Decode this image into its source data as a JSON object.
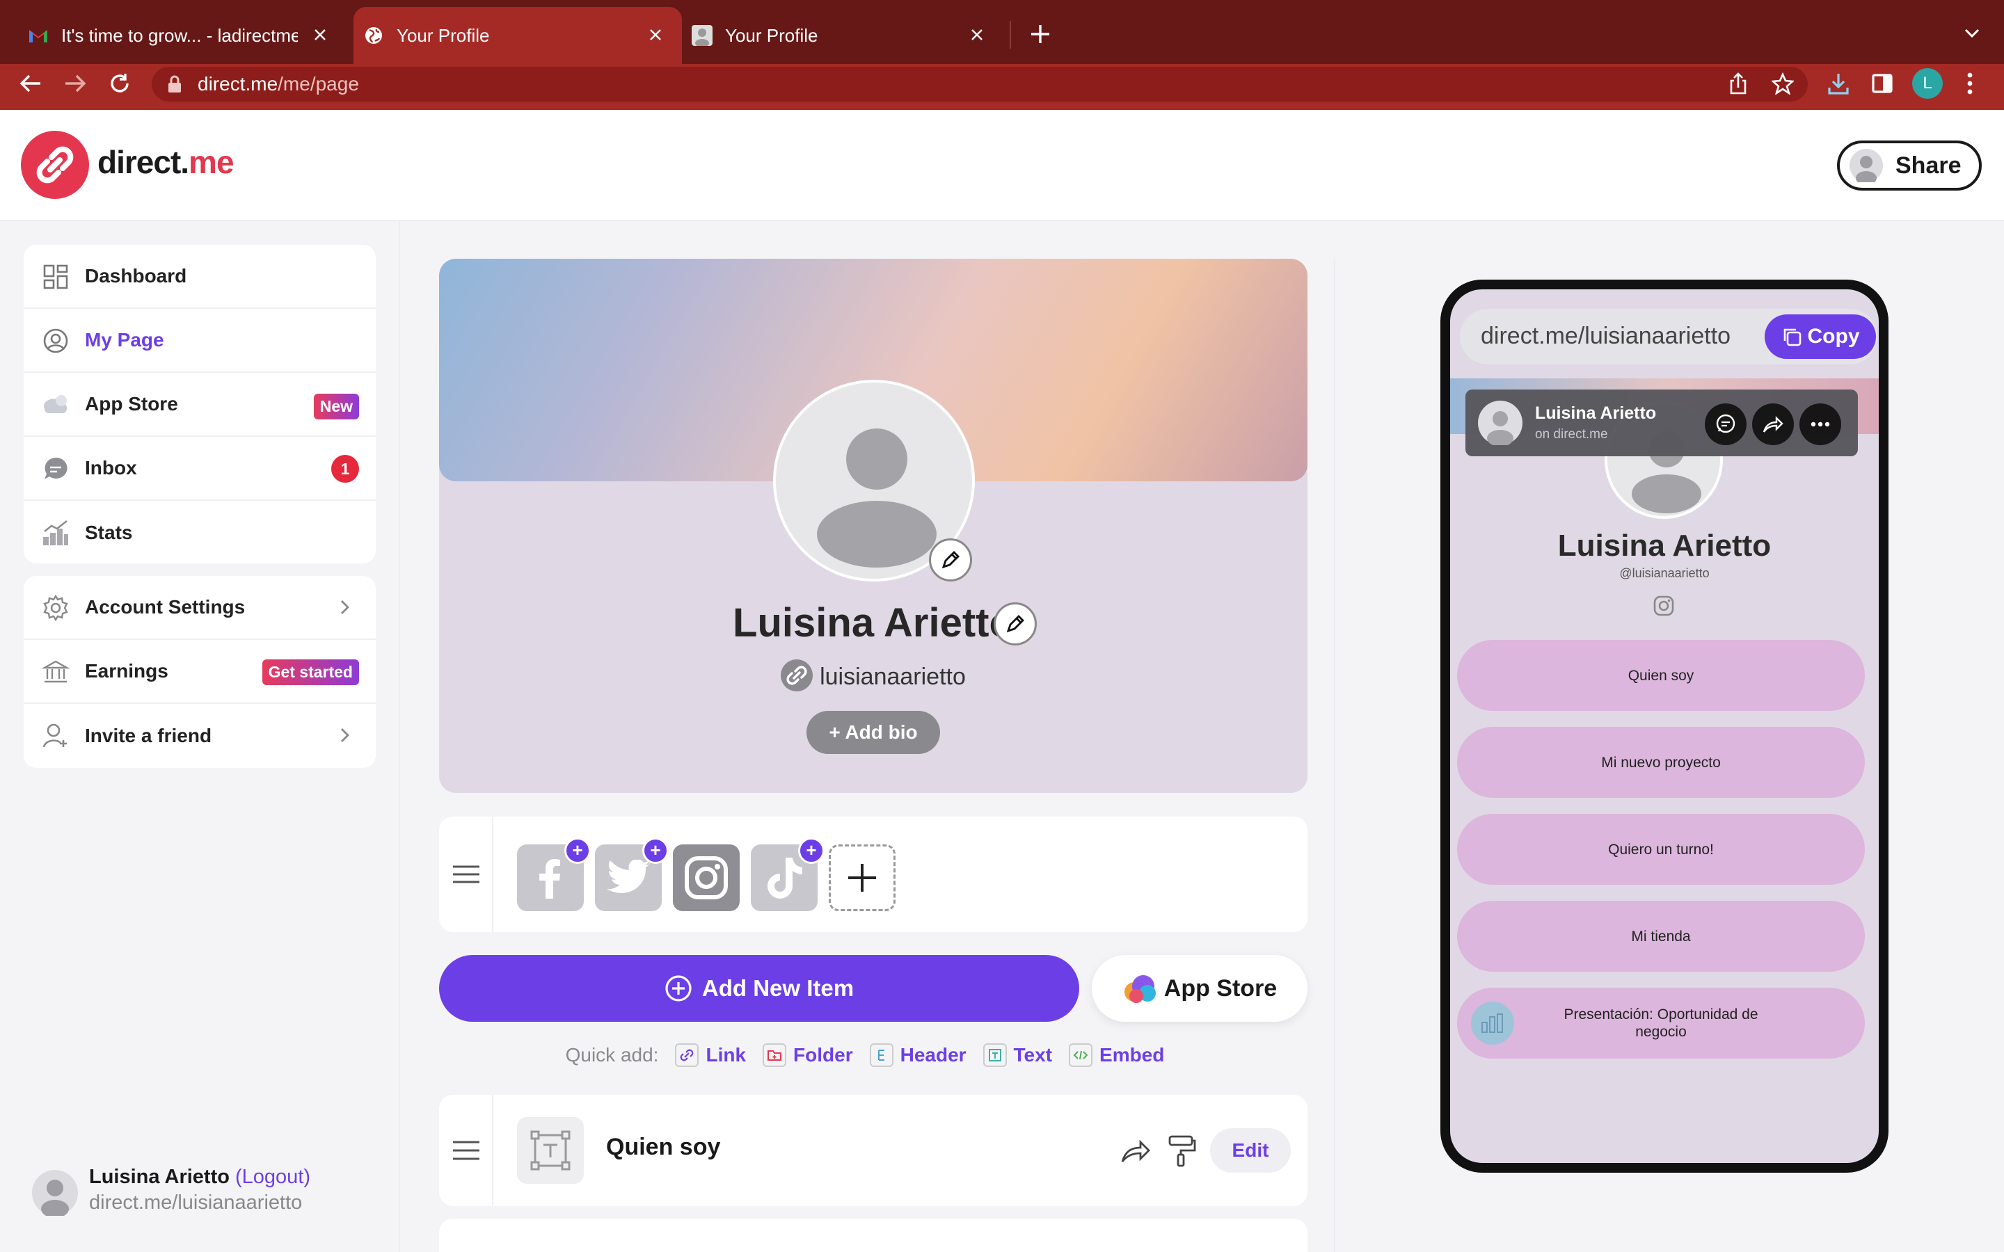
{
  "browser": {
    "tabs": [
      {
        "title": "It's time to grow... - ladirectme",
        "favicon": "gmail-icon"
      },
      {
        "title": "Your Profile",
        "favicon": "globe-icon"
      },
      {
        "title": "Your Profile",
        "favicon": "page-icon"
      }
    ],
    "url_host": "direct.me",
    "url_path": "/me/page",
    "profile_initial": "L"
  },
  "header": {
    "logo_main": "direct.",
    "logo_accent": "me",
    "share_label": "Share"
  },
  "sidebar": {
    "main": [
      {
        "label": "Dashboard",
        "icon": "grid-icon"
      },
      {
        "label": "My Page",
        "icon": "user-circle-icon",
        "selected": true
      },
      {
        "label": "App Store",
        "icon": "app-store-icon",
        "badge": "New"
      },
      {
        "label": "Inbox",
        "icon": "inbox-icon",
        "count": "1"
      },
      {
        "label": "Stats",
        "icon": "stats-icon"
      }
    ],
    "secondary": [
      {
        "label": "Account Settings",
        "icon": "gear-icon"
      },
      {
        "label": "Earnings",
        "icon": "bank-icon",
        "badge": "Get started"
      },
      {
        "label": "Invite a friend",
        "icon": "add-user-icon"
      }
    ],
    "user": {
      "name": "Luisina Arietto",
      "logout": "(Logout)",
      "url": "direct.me/luisianaarietto"
    }
  },
  "profile": {
    "name": "Luisina Arietto",
    "username": "luisianaarietto",
    "add_bio": "+ Add bio"
  },
  "social_icons": [
    "facebook-icon",
    "twitter-icon",
    "instagram-icon",
    "tiktok-icon",
    "add-icon"
  ],
  "actions": {
    "add_new": "Add New Item",
    "app_store": "App Store",
    "quick_add_label": "Quick add:",
    "quick_add": [
      "Link",
      "Folder",
      "Header",
      "Text",
      "Embed"
    ]
  },
  "items": [
    {
      "title": "Quien soy",
      "edit": "Edit"
    }
  ],
  "preview": {
    "url": "direct.me/luisianaarietto",
    "copy": "Copy",
    "bar_name": "Luisina Arietto",
    "bar_sub": "on direct.me",
    "name": "Luisina Arietto",
    "handle": "@luisianaarietto",
    "links": [
      "Quien soy",
      "Mi nuevo proyecto",
      "Quiero un turno!",
      "Mi tienda",
      "Presentación: Oportunidad de negocio"
    ]
  },
  "colors": {
    "accent": "#6c3fe6",
    "brand": "#e4374f",
    "chrome": "#a52a25"
  }
}
